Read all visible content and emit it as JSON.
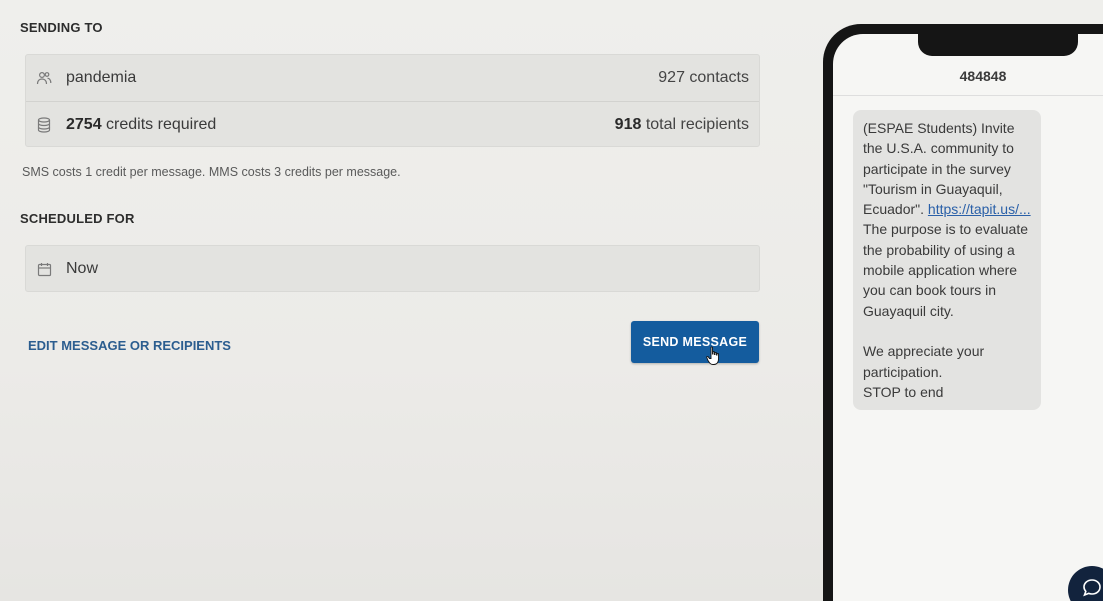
{
  "sending_to": {
    "title": "SENDING TO",
    "list_name": "pandemia",
    "contacts_count": "927 contacts",
    "credits_value": "2754",
    "credits_label": "credits required",
    "recipients_value": "918",
    "recipients_label": "total recipients"
  },
  "cost_note": "SMS costs 1 credit per message. MMS costs 3 credits per message.",
  "scheduled": {
    "title": "SCHEDULED FOR",
    "value": "Now"
  },
  "actions": {
    "edit_label": "EDIT MESSAGE OR RECIPIENTS",
    "send_label": "SEND MESSAGE"
  },
  "preview": {
    "sender": "484848",
    "message_part1": "(ESPAE Students) Invite the U.S.A. community to participate in the survey \"Tourism in Guayaquil, Ecuador\".",
    "link_text": "https://tapit.us/...",
    "message_part2": "The purpose is to evaluate the probability of using a mobile application where you can book tours in Guayaquil city.",
    "message_part3": "We appreciate your participation.",
    "message_part4": "STOP to end"
  },
  "colors": {
    "primary": "#145c9e",
    "link": "#2b5d8f"
  },
  "icons": {
    "list": "people-icon",
    "credits": "database-icon",
    "schedule": "calendar-icon",
    "chat": "chat-bubble-icon"
  }
}
